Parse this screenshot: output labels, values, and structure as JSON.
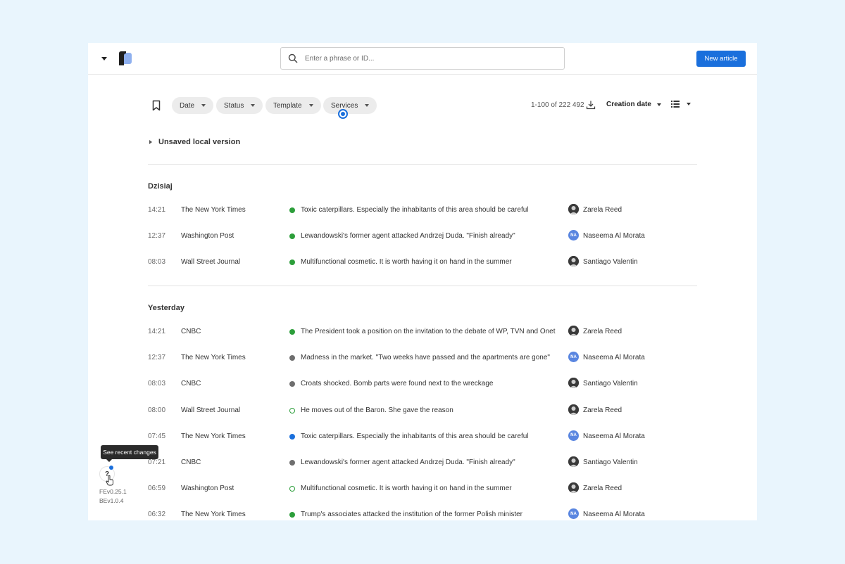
{
  "topbar": {
    "search_placeholder": "Enter a phrase or ID...",
    "search_value": "",
    "new_article_label": "New article"
  },
  "filters": {
    "chips": [
      {
        "label": "Date"
      },
      {
        "label": "Status"
      },
      {
        "label": "Template"
      },
      {
        "label": "Services"
      }
    ],
    "results_count": "1-100 of 222 492",
    "sort_label": "Creation date"
  },
  "unsaved_label": "Unsaved local version",
  "colors": {
    "accent": "#1a6fdc",
    "published": "#2c9e3a",
    "draft": "#6e6e6e",
    "scheduled": "#1a6fdc"
  },
  "sections": [
    {
      "title": "Dzisiaj",
      "rows": [
        {
          "time": "14:21",
          "source": "The New York Times",
          "status": "green",
          "title": "Toxic caterpillars. Especially the inhabitants of this area should be careful",
          "avatar": "photo",
          "avatar_text": "",
          "author": "Zarela Reed"
        },
        {
          "time": "12:37",
          "source": "Washington Post",
          "status": "green",
          "title": "Lewandowski's former agent attacked Andrzej Duda. \"Finish already\"",
          "avatar": "na",
          "avatar_text": "NA",
          "author": "Naseema Al Morata"
        },
        {
          "time": "08:03",
          "source": "Wall Street Journal",
          "status": "green",
          "title": "Multifunctional cosmetic. It is worth having it on hand in the summer",
          "avatar": "photo",
          "avatar_text": "",
          "author": "Santiago Valentin"
        }
      ]
    },
    {
      "title": "Yesterday",
      "rows": [
        {
          "time": "14:21",
          "source": "CNBC",
          "status": "green",
          "title": "The President took a position on the invitation to the debate of WP, TVN and Onet",
          "avatar": "photo",
          "avatar_text": "",
          "author": "Zarela Reed"
        },
        {
          "time": "12:37",
          "source": "The New York Times",
          "status": "gray",
          "title": "Madness in the market. \"Two weeks have passed and the apartments are gone\"",
          "avatar": "na",
          "avatar_text": "NA",
          "author": "Naseema Al Morata"
        },
        {
          "time": "08:03",
          "source": "CNBC",
          "status": "gray",
          "title": "Croats shocked. Bomb parts were found next to the wreckage",
          "avatar": "photo",
          "avatar_text": "",
          "author": "Santiago Valentin"
        },
        {
          "time": "08:00",
          "source": "Wall Street Journal",
          "status": "outline",
          "title": "He moves out of the Baron. She gave the reason",
          "avatar": "photo",
          "avatar_text": "",
          "author": "Zarela Reed"
        },
        {
          "time": "07:45",
          "source": "The New York Times",
          "status": "blue",
          "title": "Toxic caterpillars. Especially the inhabitants of this area should be careful",
          "avatar": "na",
          "avatar_text": "NA",
          "author": "Naseema Al Morata"
        },
        {
          "time": "07:21",
          "source": "CNBC",
          "status": "gray",
          "title": "Lewandowski's former agent attacked Andrzej Duda. \"Finish already\"",
          "avatar": "photo",
          "avatar_text": "",
          "author": "Santiago Valentin"
        },
        {
          "time": "06:59",
          "source": "Washington Post",
          "status": "outline",
          "title": "Multifunctional cosmetic. It is worth having it on hand in the summer",
          "avatar": "photo",
          "avatar_text": "",
          "author": "Zarela Reed"
        },
        {
          "time": "06:32",
          "source": "The New York Times",
          "status": "green",
          "title": "Trump's associates attacked the institution of the former Polish minister",
          "avatar": "na",
          "avatar_text": "NA",
          "author": "Naseema Al Morata"
        }
      ]
    }
  ],
  "help": {
    "tooltip": "See recent changes",
    "label": "?",
    "fe_version": "FEv0.25.1",
    "be_version": "BEv1.0.4"
  }
}
